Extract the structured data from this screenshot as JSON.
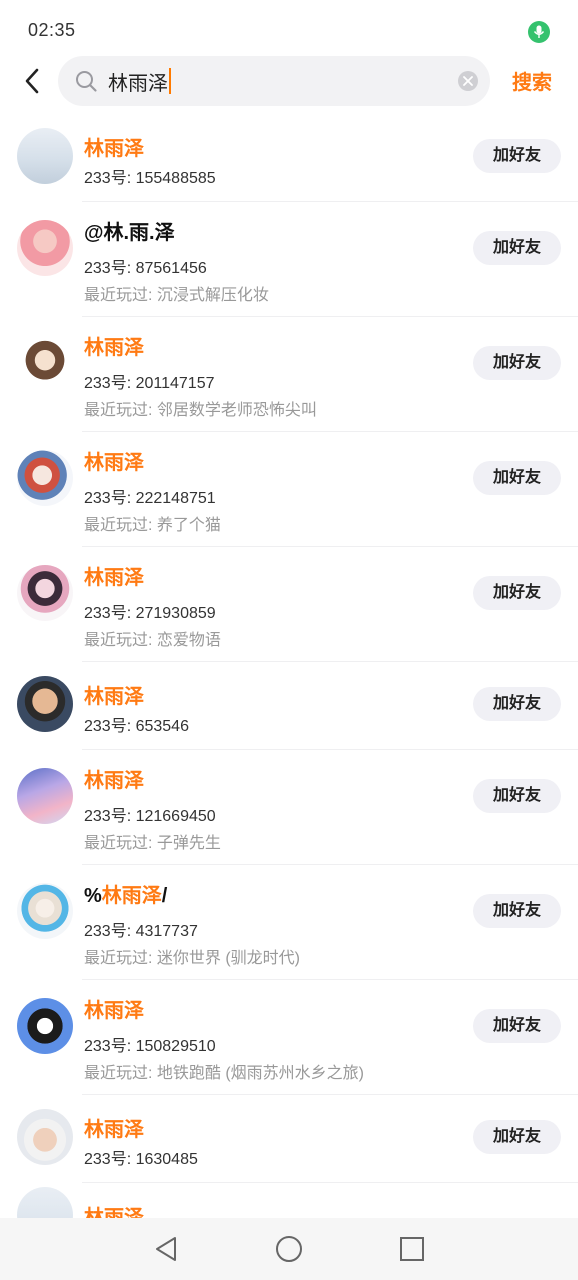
{
  "status_bar": {
    "time": "02:35",
    "mic_icon": "microphone-icon",
    "mic_color": "#35c26e"
  },
  "search": {
    "query": "林雨泽",
    "submit_label": "搜索",
    "accent": "#ff7a13"
  },
  "results": [
    {
      "name_prefix": "",
      "name_highlight": "林雨泽",
      "name_suffix": "",
      "id_label": "233号: 155488585",
      "recent": "",
      "button": "加好友"
    },
    {
      "name_prefix": "@林.雨.泽",
      "name_highlight": "",
      "name_suffix": "",
      "id_label": "233号: 87561456",
      "recent": "最近玩过: 沉浸式解压化妆",
      "button": "加好友"
    },
    {
      "name_prefix": "",
      "name_highlight": "林雨泽",
      "name_suffix": "",
      "id_label": "233号: 201147157",
      "recent": "最近玩过: 邻居数学老师恐怖尖叫",
      "button": "加好友"
    },
    {
      "name_prefix": "",
      "name_highlight": "林雨泽",
      "name_suffix": "",
      "id_label": "233号: 222148751",
      "recent": "最近玩过: 养了个猫",
      "button": "加好友"
    },
    {
      "name_prefix": "",
      "name_highlight": "林雨泽",
      "name_suffix": "",
      "id_label": "233号: 271930859",
      "recent": "最近玩过: 恋爱物语",
      "button": "加好友"
    },
    {
      "name_prefix": "",
      "name_highlight": "林雨泽",
      "name_suffix": "",
      "id_label": "233号: 653546",
      "recent": "",
      "button": "加好友"
    },
    {
      "name_prefix": "",
      "name_highlight": "林雨泽",
      "name_suffix": "",
      "id_label": "233号: 121669450",
      "recent": "最近玩过: 子弹先生",
      "button": "加好友"
    },
    {
      "name_prefix": "%",
      "name_highlight": "林雨泽",
      "name_suffix": "/",
      "id_label": "233号: 4317737",
      "recent": "最近玩过: 迷你世界 (驯龙时代)",
      "button": "加好友"
    },
    {
      "name_prefix": "",
      "name_highlight": "林雨泽",
      "name_suffix": "",
      "id_label": "233号: 150829510",
      "recent": "最近玩过: 地铁跑酷 (烟雨苏州水乡之旅)",
      "button": "加好友"
    },
    {
      "name_prefix": "",
      "name_highlight": "林雨泽",
      "name_suffix": "",
      "id_label": "233号: 1630485",
      "recent": "",
      "button": "加好友"
    },
    {
      "name_prefix": "",
      "name_highlight": "林雨泽",
      "name_suffix": "",
      "id_label": "",
      "recent": "",
      "button": ""
    }
  ],
  "nav_bar": {
    "back_icon": "triangle-back-icon",
    "home_icon": "circle-home-icon",
    "recents_icon": "square-recents-icon"
  }
}
